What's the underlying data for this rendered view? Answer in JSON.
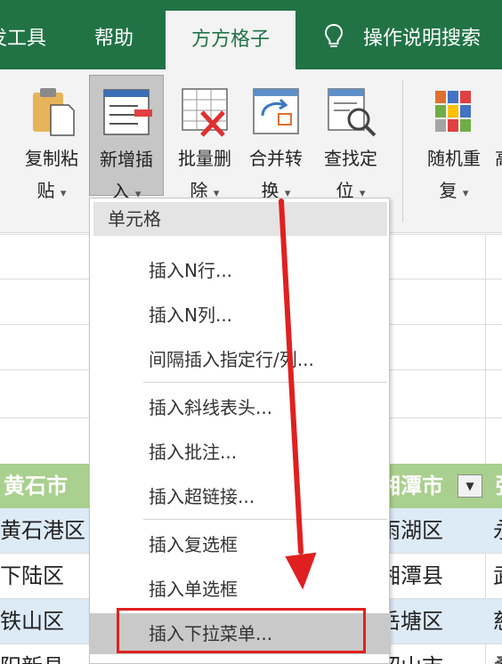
{
  "tabs": {
    "tools": "发工具",
    "help": "帮助",
    "ffgz": "方方格子",
    "search": "操作说明搜索"
  },
  "ribbon": {
    "paste": {
      "line1": "复制粘",
      "line2": "贴"
    },
    "insert": {
      "line1": "新增插",
      "line2": "入"
    },
    "delete": {
      "line1": "批量删",
      "line2": "除"
    },
    "merge": {
      "line1": "合并转",
      "line2": "换"
    },
    "find": {
      "line1": "查找定",
      "line2": "位"
    },
    "random": {
      "line1": "随机重",
      "line2": "复"
    },
    "more": {
      "line1": "高"
    }
  },
  "menu": {
    "header": "单元格",
    "items": [
      "插入N行...",
      "插入N列...",
      "间隔插入指定行/列...",
      "插入斜线表头...",
      "插入批注...",
      "插入超链接...",
      "插入复选框",
      "插入单选框",
      "插入下拉菜单..."
    ]
  },
  "sheet": {
    "header_left": "黄石市",
    "header_right": "湘潭市",
    "header_far": "张",
    "rows": [
      {
        "left": "黄石港区",
        "right": "雨湖区",
        "far": "永"
      },
      {
        "left": "下陆区",
        "right": "湘潭县",
        "far": "武"
      },
      {
        "left": "铁山区",
        "right": "岳塘区",
        "far": "慈"
      },
      {
        "left": "阳新县",
        "right": "韶山市",
        "far": "桑"
      }
    ]
  },
  "colors": {
    "tab_bar": "#217346",
    "sheet_header": "#a9d08e",
    "sheet_band": "#ddebf7",
    "highlight": "#e02020"
  }
}
